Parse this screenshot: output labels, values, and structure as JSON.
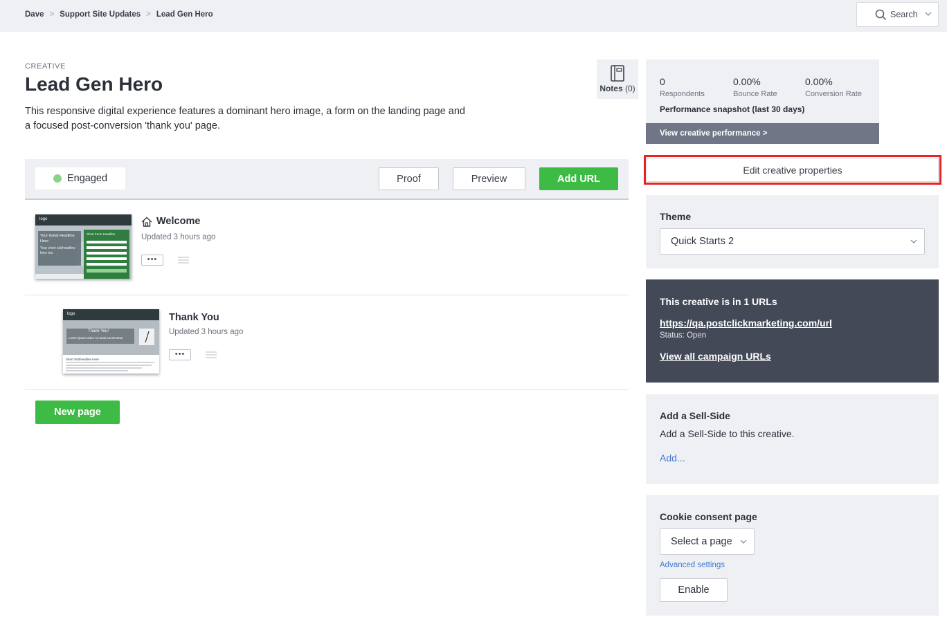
{
  "breadcrumb": [
    "Dave",
    "Support Site Updates",
    "Lead Gen Hero"
  ],
  "breadcrumb_separator": ">",
  "search": {
    "label": "Search"
  },
  "creative": {
    "kicker": "CREATIVE",
    "title": "Lead Gen Hero",
    "description": "This responsive digital experience features a dominant hero image, a form on the landing page and a focused post-conversion 'thank you' page."
  },
  "notes": {
    "label": "Notes",
    "count": "(0)"
  },
  "toolbar": {
    "status": "Engaged",
    "status_color": "#8ed18a",
    "proof_label": "Proof",
    "preview_label": "Preview",
    "add_url_label": "Add URL"
  },
  "pages": [
    {
      "name": "Welcome",
      "updated": "Updated 3 hours ago",
      "home_icon": "home-icon",
      "thumb": {
        "logo": "logo",
        "headline": "Your Great Headline Here",
        "subheadline": "Your short subheadline here too",
        "form_title": "Short Form Headline"
      }
    },
    {
      "name": "Thank You",
      "updated": "Updated 3 hours ago",
      "thumb": {
        "logo": "logo",
        "headline": "Thank You!",
        "subheadline": "Lorem ipsum dolor sit amet consectetur",
        "section": "Short Subheadline Here"
      }
    }
  ],
  "new_page_label": "New page",
  "performance": {
    "respondents_value": "0",
    "respondents_label": "Respondents",
    "bounce_value": "0.00%",
    "bounce_label": "Bounce Rate",
    "conversion_value": "0.00%",
    "conversion_label": "Conversion Rate",
    "snapshot": "Performance snapshot (last 30 days)",
    "link": "View creative performance >"
  },
  "edit_properties_label": "Edit creative properties",
  "theme": {
    "heading": "Theme",
    "selected": "Quick Starts 2"
  },
  "urls": {
    "heading": "This creative is in 1 URLs",
    "url": "https://qa.postclickmarketing.com/url",
    "status": "Status: Open",
    "view_all": "View all campaign URLs"
  },
  "sell_side": {
    "heading": "Add a Sell-Side",
    "text": "Add a Sell-Side to this creative.",
    "add_link": "Add..."
  },
  "cookie": {
    "heading": "Cookie consent page",
    "selected": "Select a page",
    "advanced": "Advanced settings",
    "enable_label": "Enable"
  },
  "colors": {
    "accent_green": "#3dbb45",
    "highlight_red": "#e8231f",
    "dark_panel": "#434957",
    "link_blue": "#3f7ad3"
  }
}
